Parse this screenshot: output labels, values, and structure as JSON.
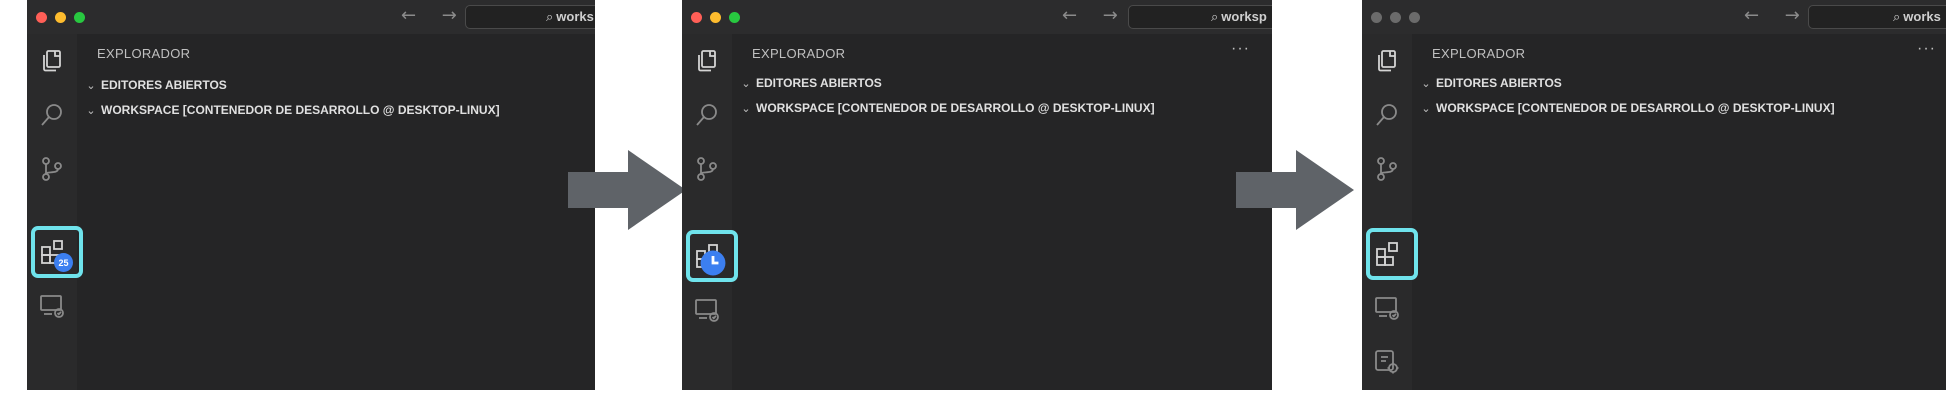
{
  "panels": [
    {
      "explorer_title": "EXPLORADOR",
      "search_text": "works",
      "sections": [
        "EDITORES ABIERTOS",
        "WORKSPACE [CONTENEDOR DE DESARROLLO @ DESKTOP-LINUX]"
      ],
      "extensions_badge": "25",
      "more_actions": ""
    },
    {
      "explorer_title": "EXPLORADOR",
      "search_text": "worksp",
      "sections": [
        "EDITORES ABIERTOS",
        "WORKSPACE [CONTENEDOR DE DESARROLLO @ DESKTOP-LINUX]"
      ],
      "more_actions": "···"
    },
    {
      "explorer_title": "EXPLORADOR",
      "search_text": "works",
      "sections": [
        "EDITORES ABIERTOS",
        "WORKSPACE [CONTENEDOR DE DESARROLLO @ DESKTOP-LINUX]"
      ],
      "more_actions": "···"
    }
  ],
  "nav_arrows": "← →",
  "colors": {
    "highlight": "#6fe3ec",
    "badge": "#3c7ff0",
    "arrow": "#5f6368",
    "traffic_red": "#ff5f57",
    "traffic_yellow": "#febc2e",
    "traffic_green": "#28c840",
    "traffic_inactive": "#6b6b6b"
  }
}
